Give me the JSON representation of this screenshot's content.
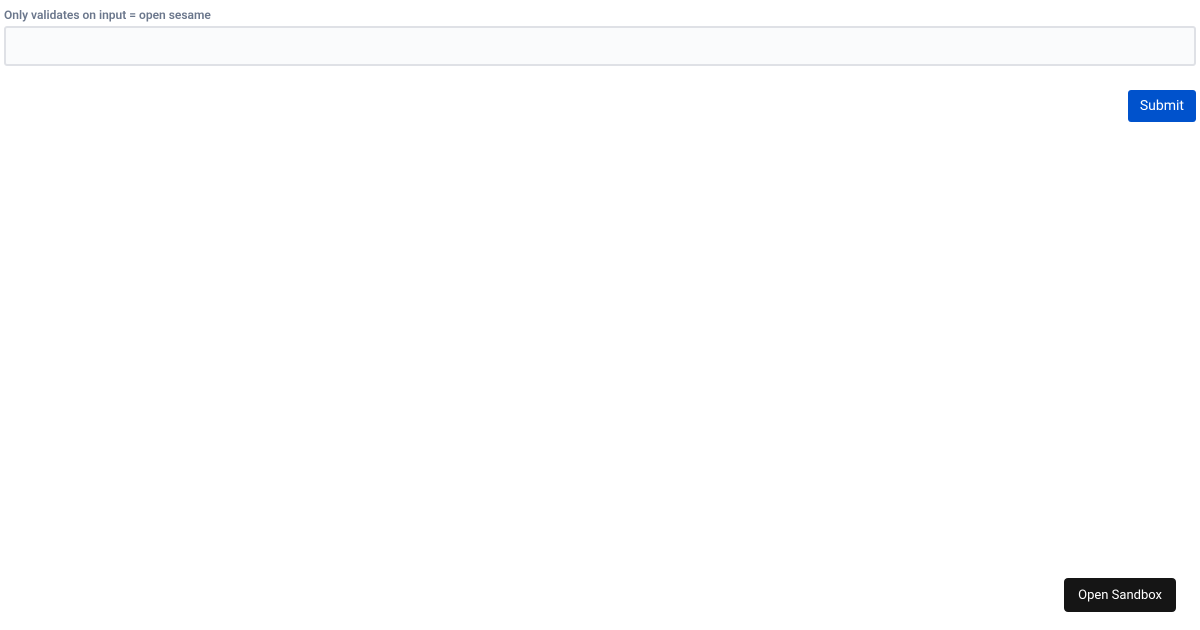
{
  "form": {
    "field_label": "Only validates on input = open sesame",
    "field_value": "",
    "submit_label": "Submit"
  },
  "footer": {
    "open_sandbox_label": "Open Sandbox"
  }
}
